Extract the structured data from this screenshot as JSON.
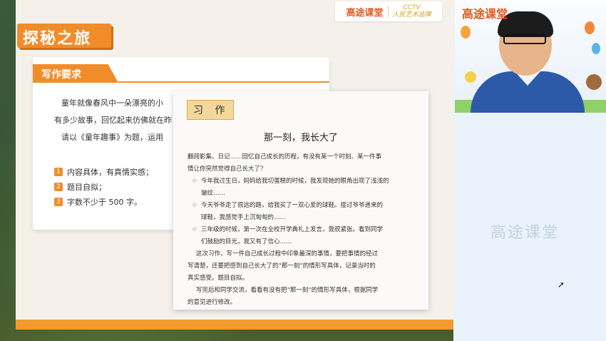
{
  "brand": {
    "name": "高途课堂",
    "cctv": "CCTV",
    "cctv_sub": "人民艺术品牌"
  },
  "slide": {
    "banner_title": "探秘之旅",
    "requirements": {
      "heading": "写作要求",
      "lines": [
        "童年就像春风中一朵漂亮的小",
        "有多少故事，回忆起来仿佛就在昨",
        "请以《童年趣事》为题，运用"
      ],
      "items": [
        {
          "num": "1",
          "text": "内容具体，有真情实感；"
        },
        {
          "num": "2",
          "text": "题目自拟；"
        },
        {
          "num": "3",
          "text": "字数不少于 500 字。"
        }
      ]
    },
    "composition": {
      "tag": "习 作",
      "title": "那一刻，我长大了",
      "intro": [
        "翻阅影集、日记……回忆自己成长的历程，有没有某一个时刻、某一件事",
        "情让你突然觉得自己长大了？"
      ],
      "examples": [
        [
          "今年我过生日，妈妈给我切蛋糕的时候，我发现她的眼角出现了浅浅的",
          "皱纹……"
        ],
        [
          "今天爷爷走了很远的路，给我买了一双心爱的球鞋。接过爷爷递来的",
          "球鞋，我感觉手上沉甸甸的……"
        ],
        [
          "三年级的时候，第一次在全校开学典礼上发言，我很紧张。看到同学",
          "们鼓励的目光，我又有了信心……"
        ]
      ],
      "body": [
        "这次习作，写一件自己成长过程中印象最深的事情，要把事情的经过",
        "写清楚，还要把感到自己长大了的“那一刻”的情形写具体，记录当时的",
        "真实感受。题目自拟。",
        "写完后和同学交流，看看有没有把“那一刻”的情形写具体，根据同学",
        "的意见进行修改。"
      ]
    }
  },
  "video": {
    "brand": "高途课堂"
  },
  "watermark": "高途课堂",
  "colors": {
    "accent": "#f18c2a",
    "brand": "#e05a1f"
  }
}
